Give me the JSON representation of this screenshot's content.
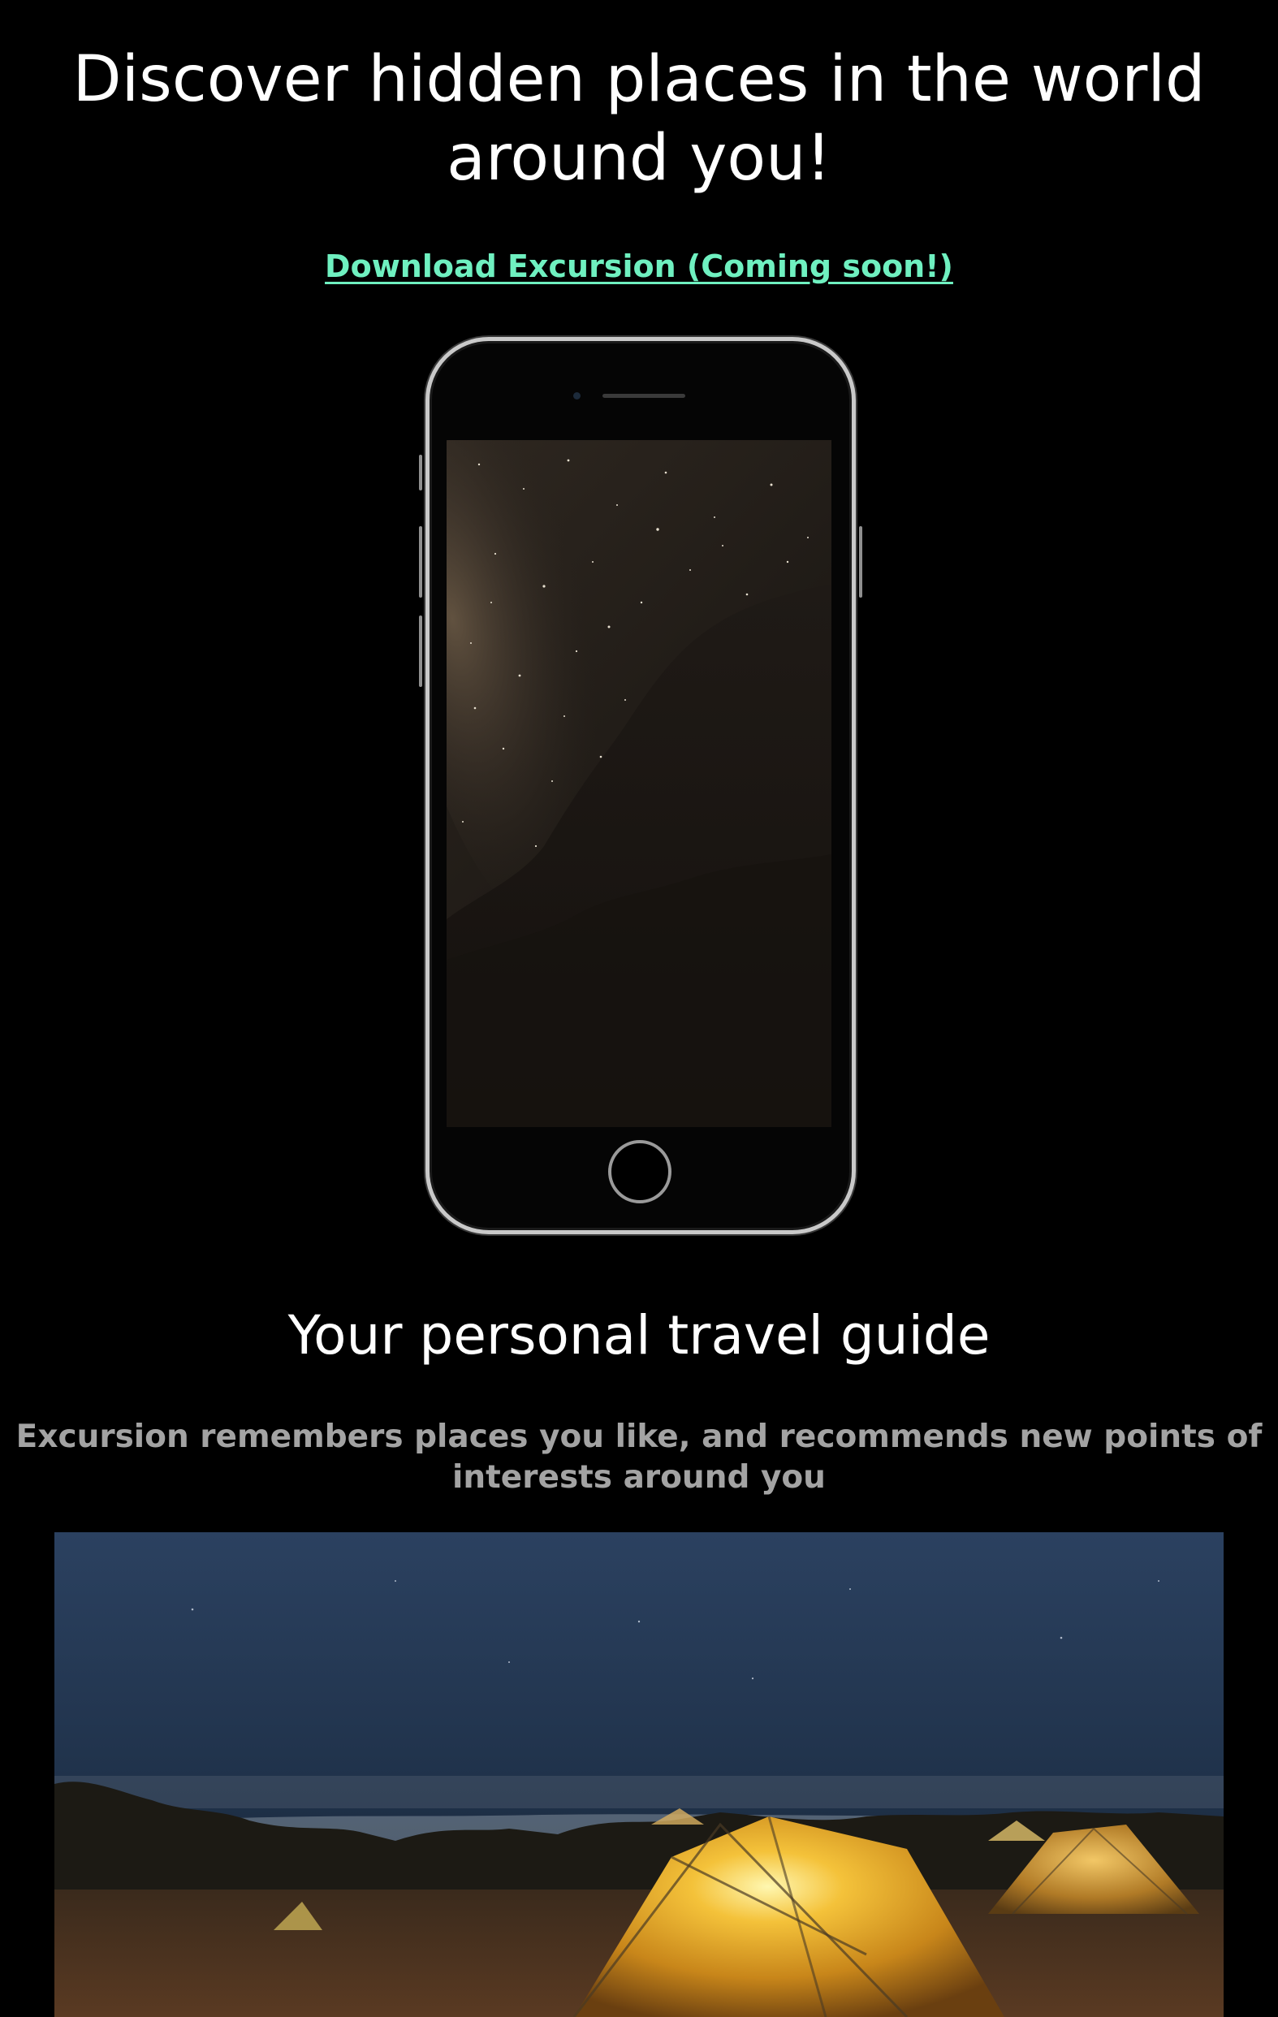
{
  "hero": {
    "title": "Discover hidden places in the world around you!",
    "download_link": "Download Excursion (Coming soon!)"
  },
  "feature": {
    "title": "Your personal travel guide",
    "description": "Excursion remembers places you like, and recommends new points of interests around you"
  },
  "colors": {
    "background": "#000000",
    "link": "#6ff0c0",
    "description_text": "#a3a3a3"
  }
}
